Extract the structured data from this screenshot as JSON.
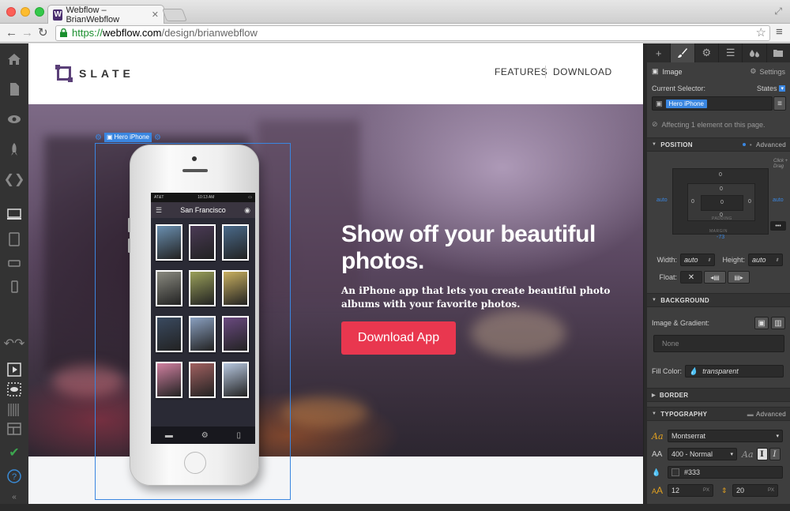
{
  "browser": {
    "tab_title": "Webflow – BrianWebflow",
    "favicon_letter": "W",
    "url_https": "https://",
    "url_domain": "webflow.com",
    "url_path": "/design/brianwebflow"
  },
  "site": {
    "logo_text": "SLATE",
    "nav": [
      "FEATURES",
      "DOWNLOAD"
    ],
    "hero_title": "Show off your beautiful photos.",
    "hero_subtitle": "An iPhone app that lets you create beautiful photo albums with your favorite photos.",
    "hero_button": "Download App",
    "selected_element_tag": "Hero iPhone"
  },
  "phone": {
    "carrier": "AT&T",
    "time": "10:13 AM",
    "title": "San Francisco",
    "photo_colors": [
      "#6a8fb0",
      "#4a3a55",
      "#4a6a8a",
      "#8a8a80",
      "#9aa05a",
      "#c9b060",
      "#3a4a60",
      "#8aa0c0",
      "#6a4a80",
      "#d080a0",
      "#a06060",
      "#b8c8e0"
    ]
  },
  "panel": {
    "tabs": [
      "plus-icon",
      "brush-icon",
      "gear-icon",
      "list-icon",
      "drops-icon",
      "folder-icon"
    ],
    "element_type": "Image",
    "settings_label": "Settings",
    "current_selector_label": "Current Selector:",
    "states_label": "States",
    "selector_chip": "Hero iPhone",
    "affecting_text": "Affecting 1 element on this page.",
    "position": {
      "title": "POSITION",
      "advanced": "Advanced",
      "margin_top": "0",
      "padding_top": "0",
      "padding_left": "0",
      "padding_right": "0",
      "padding_bottom": "0",
      "core_value": "0",
      "margin_left": "auto",
      "margin_right": "auto",
      "margin_bottom": "-73",
      "inner_left": "0",
      "inner_right": "0",
      "padding_label": "PADDING",
      "margin_label": "MARGIN",
      "hint": "Click + Drag",
      "more": "•••"
    },
    "width_label": "Width:",
    "width_value": "auto",
    "height_label": "Height:",
    "height_value": "auto",
    "float_label": "Float:",
    "background": {
      "title": "BACKGROUND",
      "image_label": "Image & Gradient:",
      "none": "None",
      "fill_label": "Fill Color:",
      "fill_value": "transparent"
    },
    "border_title": "BORDER",
    "typography": {
      "title": "TYPOGRAPHY",
      "advanced": "Advanced",
      "font": "Montserrat",
      "weight": "400 - Normal",
      "color": "#333",
      "size": "12",
      "size_unit": "PX",
      "line_height": "20",
      "line_unit": "PX"
    }
  },
  "colors": {
    "brand": "#5a3f78",
    "cta": "#e9374f",
    "selection": "#3a86e0"
  }
}
